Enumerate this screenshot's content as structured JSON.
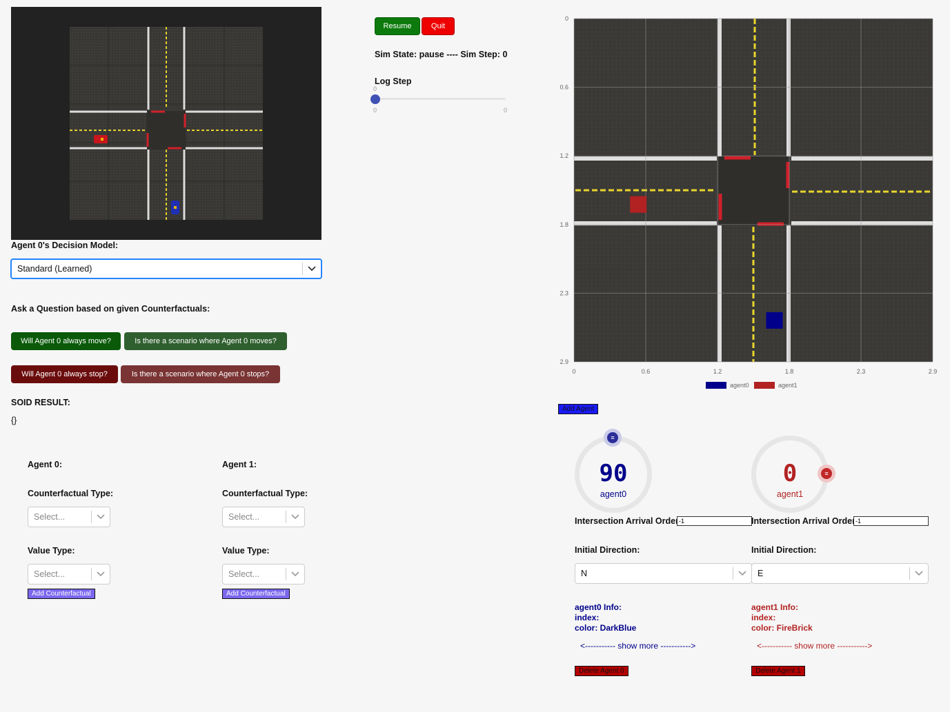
{
  "sim_controls": {
    "resume_label": "Resume",
    "quit_label": "Quit",
    "status_text": "Sim State: pause ---- Sim Step: 0",
    "log_step_label": "Log Step",
    "log_step_value": "0",
    "log_step_min": "0",
    "log_step_max": "0"
  },
  "decision_model": {
    "label": "Agent 0's Decision Model:",
    "selected": "Standard (Learned)"
  },
  "questions": {
    "heading": "Ask a Question based on given Counterfactuals:",
    "always_move": "Will Agent 0 always move?",
    "scenario_moves": "Is there a scenario where Agent 0 moves?",
    "always_stop": "Will Agent 0 always stop?",
    "scenario_stops": "Is there a scenario where Agent 0 stops?"
  },
  "soid": {
    "label": "SOID RESULT:",
    "value": "{}"
  },
  "counterfactual_panels": [
    {
      "title": "Agent 0:",
      "cf_type_label": "Counterfactual Type:",
      "cf_type_placeholder": "Select...",
      "value_type_label": "Value Type:",
      "value_type_placeholder": "Select...",
      "add_label": "Add Counterfactual"
    },
    {
      "title": "Agent 1:",
      "cf_type_label": "Counterfactual Type:",
      "cf_type_placeholder": "Select...",
      "value_type_label": "Value Type:",
      "value_type_placeholder": "Select...",
      "add_label": "Add Counterfactual"
    }
  ],
  "chart_data": {
    "type": "scatter",
    "x_ticks": [
      "0",
      "0.6",
      "1.2",
      "1.8",
      "2.3",
      "2.9"
    ],
    "y_ticks": [
      "0",
      "0.6",
      "1.2",
      "1.8",
      "2.3",
      "2.9"
    ],
    "xlim": [
      0,
      2.9
    ],
    "ylim": [
      0,
      2.9
    ],
    "y_inverted": true,
    "grid": true,
    "legend_position": "bottom-center",
    "series": [
      {
        "name": "agent0",
        "color": "#00008b",
        "x": 1.62,
        "y": 2.55
      },
      {
        "name": "agent1",
        "color": "#b22222",
        "x": 0.52,
        "y": 1.57
      }
    ]
  },
  "add_agent_label": "Add Agent",
  "agents": [
    {
      "heading_value": "90",
      "name": "agent0",
      "color": "#00008b",
      "arrival_label": "Intersection Arrival Order:",
      "arrival_value": "-1",
      "direction_label": "Initial Direction:",
      "direction_value": "N",
      "info_title": "agent0 Info:",
      "info_index": "index:",
      "info_color": "color: DarkBlue",
      "show_more": "<----------- show more ----------->",
      "delete_label": "Delete Agent 0"
    },
    {
      "heading_value": "0",
      "name": "agent1",
      "color": "#b22222",
      "arrival_label": "Intersection Arrival Order:",
      "arrival_value": "-1",
      "direction_label": "Initial Direction:",
      "direction_value": "E",
      "info_title": "agent1 Info:",
      "info_index": "index:",
      "info_color": "color: FireBrick",
      "show_more": "<----------- show more ----------->",
      "delete_label": "Delete Agent 1"
    }
  ]
}
